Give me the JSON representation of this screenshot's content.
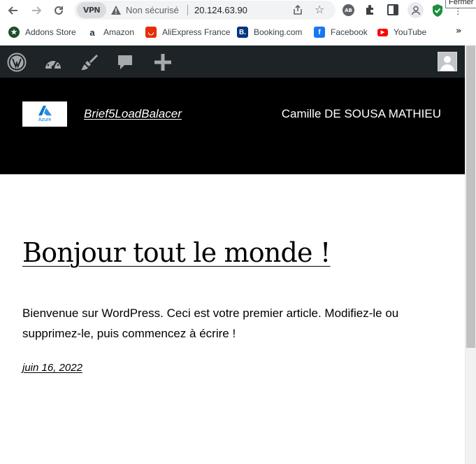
{
  "browser": {
    "vpn_label": "VPN",
    "security_label": "Non sécurisé",
    "url": "20.124.63.90",
    "tooltip": "Fermer",
    "icons": {
      "back": "back-arrow-icon",
      "forward": "forward-arrow-icon",
      "reload": "reload-icon",
      "warning": "warning-icon",
      "share": "share-icon",
      "bookmark_star": "star-icon",
      "extensions": "puzzle-icon",
      "profile": "profile-icon",
      "shield": "shield-check-icon",
      "menu": "menu-dots-icon"
    }
  },
  "bookmarks": {
    "items": [
      {
        "label": "Addons Store",
        "icon": "addons-store-icon",
        "color": "#1e4e2b"
      },
      {
        "label": "Amazon",
        "icon": "amazon-icon",
        "color": "#232f3e"
      },
      {
        "label": "AliExpress France",
        "icon": "aliexpress-icon",
        "color": "#e62e04"
      },
      {
        "label": "Booking.com",
        "icon": "booking-icon",
        "color": "#003580"
      },
      {
        "label": "Facebook",
        "icon": "facebook-icon",
        "color": "#1877f2"
      },
      {
        "label": "YouTube",
        "icon": "youtube-icon",
        "color": "#ff0000"
      }
    ],
    "more": "»"
  },
  "adminbar": {
    "items": [
      "wordpress-logo-icon",
      "dashboard-gauge-icon",
      "customize-brush-icon",
      "comments-icon",
      "new-content-plus-icon"
    ],
    "background": "#1d2327"
  },
  "site": {
    "logo_text": "Azure",
    "title": "Brief5LoadBalacer",
    "nav_item": "Camille DE SOUSA MATHIEU"
  },
  "post": {
    "title": "Bonjour tout le monde !",
    "excerpt": "Bienvenue sur WordPress. Ceci est votre premier article. Modifiez-le ou supprimez-le, puis commencez à écrire !",
    "date": "juin 16, 2022"
  }
}
